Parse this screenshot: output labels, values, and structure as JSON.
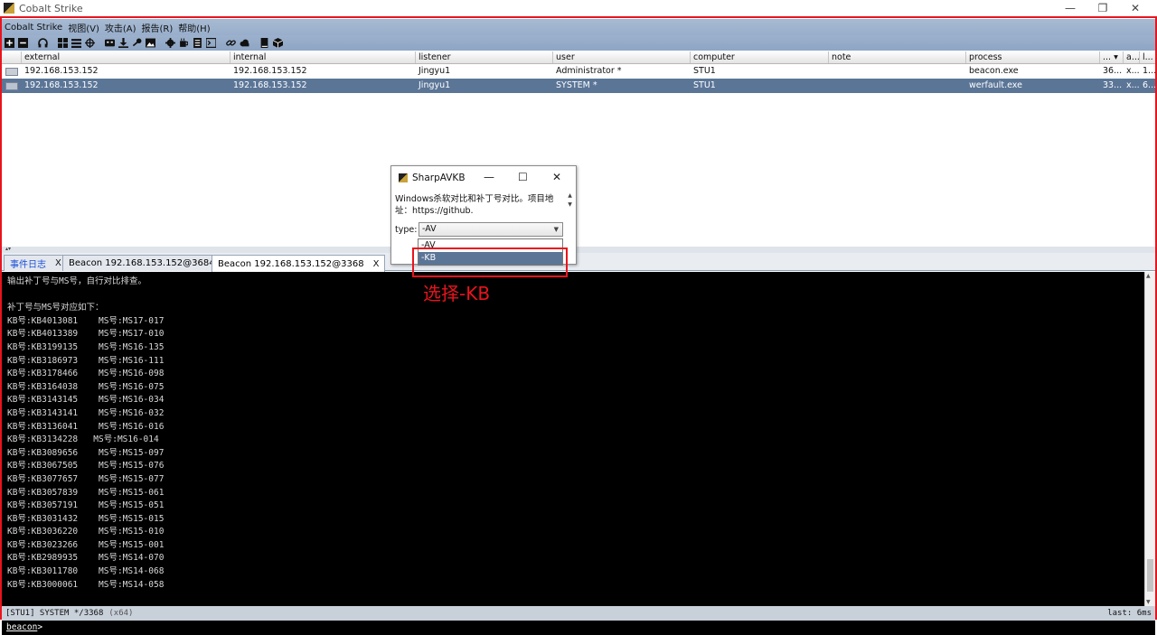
{
  "window": {
    "title": "Cobalt Strike",
    "minimize": "—",
    "restore": "❐",
    "close": "✕"
  },
  "menu": [
    "Cobalt Strike",
    "视图(V)",
    "攻击(A)",
    "报告(R)",
    "帮助(H)"
  ],
  "toolbar_icons": [
    "plus-icon",
    "minus-icon",
    "headphones-icon",
    "targets-icon",
    "list-icon",
    "crosshair-icon",
    "keys-icon",
    "download-icon",
    "key-icon",
    "image-icon",
    "gear-icon",
    "coffee-icon",
    "document-icon",
    "terminal-icon",
    "link-icon",
    "cloud-icon",
    "book-icon",
    "cube-icon"
  ],
  "table": {
    "columns": [
      "external",
      "internal",
      "listener",
      "user",
      "computer",
      "note",
      "process",
      "...",
      "a...",
      "l..."
    ],
    "rows": [
      {
        "external": "192.168.153.152",
        "internal": "192.168.153.152",
        "listener": "Jingyu1",
        "user": "Administrator *",
        "computer": "STU1",
        "note": "",
        "process": "beacon.exe",
        "pid": "36...",
        "arch": "x...",
        "last": "1...",
        "selected": false
      },
      {
        "external": "192.168.153.152",
        "internal": "192.168.153.152",
        "listener": "Jingyu1",
        "user": "SYSTEM *",
        "computer": "STU1",
        "note": "",
        "process": "werfault.exe",
        "pid": "33...",
        "arch": "x...",
        "last": "6...",
        "selected": true
      }
    ]
  },
  "tabs": [
    {
      "label": "事件日志",
      "close": "X",
      "active": false
    },
    {
      "label": "Beacon 192.168.153.152@3684",
      "close": "X",
      "active": false
    },
    {
      "label": "Beacon 192.168.153.152@3368",
      "close": "X",
      "active": true
    }
  ],
  "console": {
    "lines": [
      "输出补丁号与MS号，自行对比排查。",
      "",
      "补丁号与MS号对应如下：",
      "KB号:KB4013081    MS号:MS17-017",
      "KB号:KB4013389    MS号:MS17-010",
      "KB号:KB3199135    MS号:MS16-135",
      "KB号:KB3186973    MS号:MS16-111",
      "KB号:KB3178466    MS号:MS16-098",
      "KB号:KB3164038    MS号:MS16-075",
      "KB号:KB3143145    MS号:MS16-034",
      "KB号:KB3143141    MS号:MS16-032",
      "KB号:KB3136041    MS号:MS16-016",
      "KB号:KB3134228   MS号:MS16-014",
      "KB号:KB3089656    MS号:MS15-097",
      "KB号:KB3067505    MS号:MS15-076",
      "KB号:KB3077657    MS号:MS15-077",
      "KB号:KB3057839    MS号:MS15-061",
      "KB号:KB3057191    MS号:MS15-051",
      "KB号:KB3031432    MS号:MS15-015",
      "KB号:KB3036220    MS号:MS15-010",
      "KB号:KB3023266    MS号:MS15-001",
      "KB号:KB2989935    MS号:MS14-070",
      "KB号:KB3011780    MS号:MS14-068",
      "KB号:KB3000061    MS号:MS14-058"
    ]
  },
  "status": {
    "left": "[STU1] SYSTEM */3368",
    "arch": "(x64)",
    "right": "last: 6ms"
  },
  "prompt": {
    "label": "beacon",
    "symbol": ">"
  },
  "dialog": {
    "title": "SharpAVKB",
    "minimize": "—",
    "maximize": "☐",
    "close": "✕",
    "description": "Windows杀软对比和补丁号对比。项目地址：https://github.",
    "type_label": "type:",
    "type_value": "-AV",
    "options": [
      "-AV",
      "-KB"
    ],
    "highlighted_option": "-KB"
  },
  "annotation": {
    "text": "选择-KB",
    "color": "#e8141e"
  },
  "colors": {
    "selection": "#5b7597",
    "menubar": "#a7bad2",
    "console_bg": "#000000",
    "frame_border": "#e8141e"
  }
}
